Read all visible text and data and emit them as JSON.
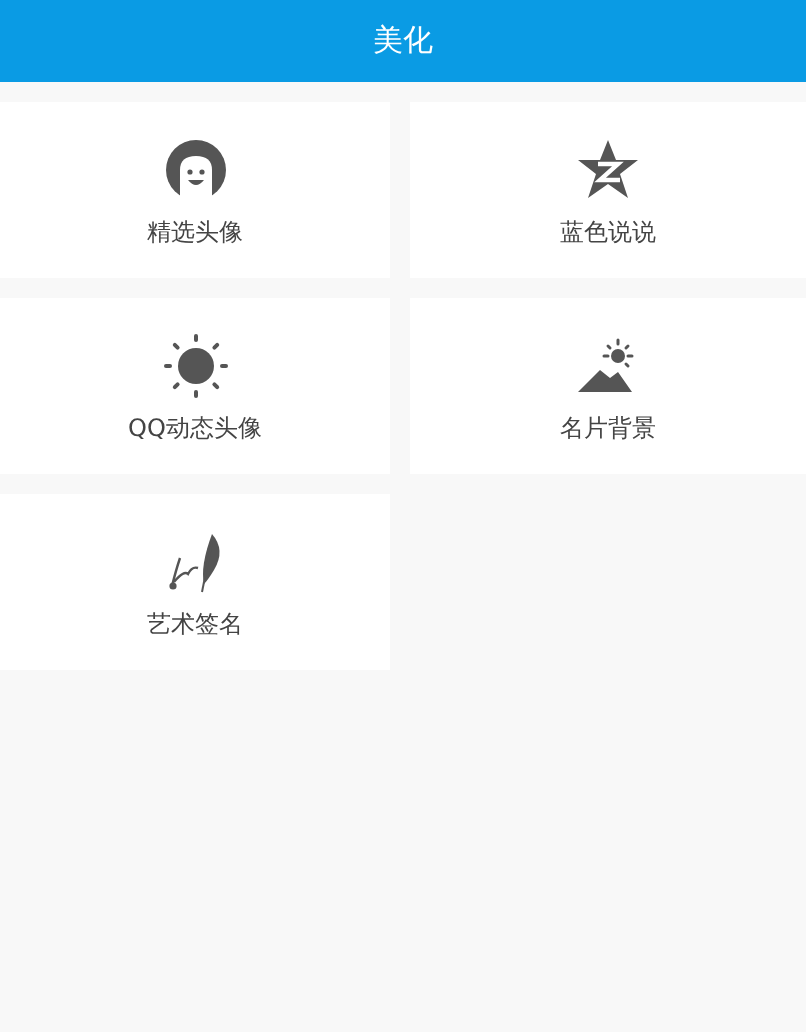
{
  "header": {
    "title": "美化"
  },
  "items": [
    {
      "label": "精选头像",
      "kind": "avatar"
    },
    {
      "label": "蓝色说说",
      "kind": "star"
    },
    {
      "label": "QQ动态头像",
      "kind": "sun"
    },
    {
      "label": "名片背景",
      "kind": "mountain"
    },
    {
      "label": "艺术签名",
      "kind": "feather"
    }
  ]
}
